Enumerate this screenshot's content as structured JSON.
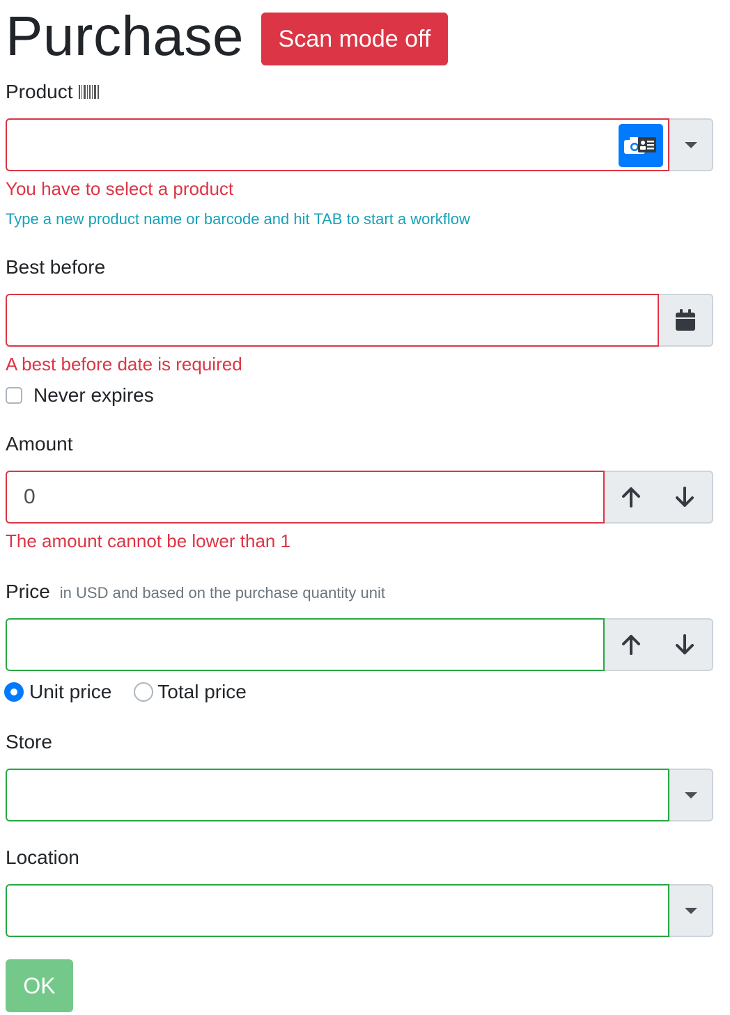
{
  "header": {
    "title": "Purchase",
    "scan_button": "Scan mode off"
  },
  "product": {
    "label": "Product",
    "barcode_icon": "barcode-icon",
    "value": "",
    "camera_icon": "camera-barcode-icon",
    "dropdown_icon": "caret-down-icon",
    "error": "You have to select a product",
    "hint": "Type a new product name or barcode and hit TAB to start a workflow"
  },
  "best_before": {
    "label": "Best before",
    "value": "",
    "calendar_icon": "calendar-icon",
    "error": "A best before date is required",
    "never_expires_label": "Never expires",
    "never_expires_checked": false
  },
  "amount": {
    "label": "Amount",
    "value": "0",
    "error": "The amount cannot be lower than 1"
  },
  "price": {
    "label": "Price",
    "help": "in USD and based on the purchase quantity unit",
    "value": "",
    "unit_price_label": "Unit price",
    "total_price_label": "Total price",
    "selected": "unit"
  },
  "store": {
    "label": "Store",
    "value": ""
  },
  "location": {
    "label": "Location",
    "value": ""
  },
  "ok_button": "OK",
  "colors": {
    "danger": "#dc3545",
    "success": "#28a745",
    "info": "#17a2b8",
    "primary": "#007bff",
    "ok_button": "#74c98a"
  }
}
